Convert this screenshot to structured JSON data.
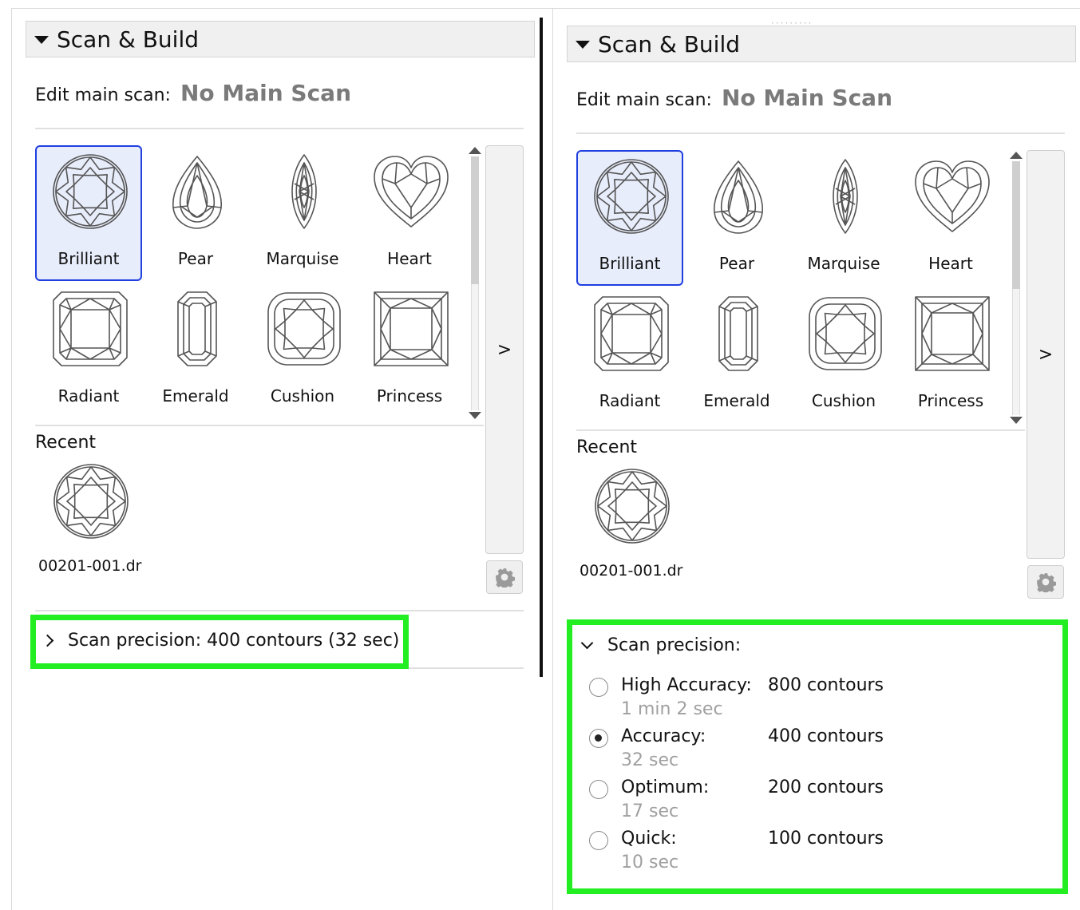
{
  "section_title": "Scan & Build",
  "edit_main_scan": {
    "label": "Edit main scan:",
    "value": "No Main Scan"
  },
  "shapes": [
    {
      "name": "brilliant",
      "label": "Brilliant",
      "selected": true
    },
    {
      "name": "pear",
      "label": "Pear",
      "selected": false
    },
    {
      "name": "marquise",
      "label": "Marquise",
      "selected": false
    },
    {
      "name": "heart",
      "label": "Heart",
      "selected": false
    },
    {
      "name": "radiant",
      "label": "Radiant",
      "selected": false
    },
    {
      "name": "emerald",
      "label": "Emerald",
      "selected": false
    },
    {
      "name": "cushion",
      "label": "Cushion",
      "selected": false
    },
    {
      "name": "princess",
      "label": "Princess",
      "selected": false
    }
  ],
  "expand_button": ">",
  "recent": {
    "label": "Recent",
    "items": [
      {
        "icon": "brilliant-shape-icon",
        "filename": "00201-001.dr"
      }
    ]
  },
  "precision_collapsed": "Scan precision: 400 contours (32 sec)",
  "precision_title": "Scan precision:",
  "precision_options": [
    {
      "name": "High Accuracy:",
      "time": "1 min 2 sec",
      "contours": "800 contours",
      "checked": false
    },
    {
      "name": "Accuracy:",
      "time": "32 sec",
      "contours": "400 contours",
      "checked": true
    },
    {
      "name": "Optimum:",
      "time": "17 sec",
      "contours": "200 contours",
      "checked": false
    },
    {
      "name": "Quick:",
      "time": "10 sec",
      "contours": "100 contours",
      "checked": false
    }
  ],
  "colors": {
    "highlight": "#22ee22",
    "selected_border": "#1f3fe0",
    "selected_bg": "#e8edfb",
    "value_gray": "#7a7a7a"
  },
  "icons": [
    "gear-icon",
    "chevron-right-icon",
    "chevron-down-icon",
    "triangle-down-icon"
  ]
}
